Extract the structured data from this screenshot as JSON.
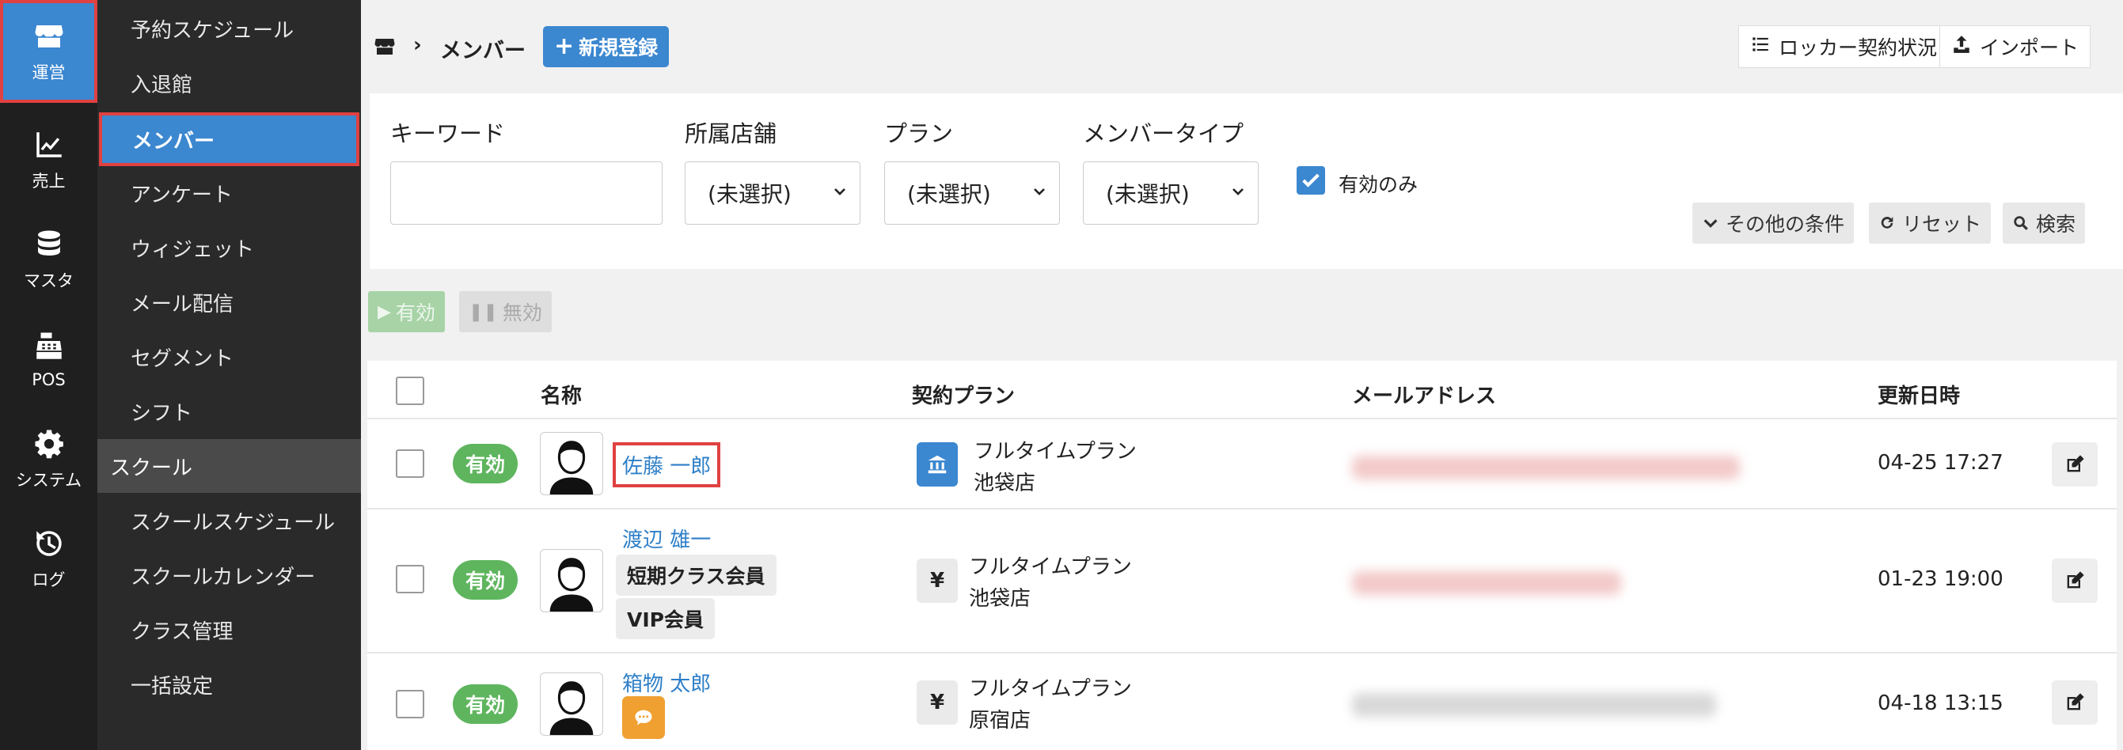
{
  "rail": [
    {
      "label": "運営",
      "icon": "store-icon"
    },
    {
      "label": "売上",
      "icon": "chart-line-icon"
    },
    {
      "label": "マスタ",
      "icon": "database-icon"
    },
    {
      "label": "POS",
      "icon": "cash-register-icon"
    },
    {
      "label": "システム",
      "icon": "gear-icon"
    },
    {
      "label": "ログ",
      "icon": "history-icon"
    }
  ],
  "nav": [
    {
      "label": "予約スケジュール"
    },
    {
      "label": "入退館"
    },
    {
      "label": "メンバー"
    },
    {
      "label": "アンケート"
    },
    {
      "label": "ウィジェット"
    },
    {
      "label": "メール配信"
    },
    {
      "label": "セグメント"
    },
    {
      "label": "シフト"
    },
    {
      "label": "スクール"
    },
    {
      "label": "スクールスケジュール"
    },
    {
      "label": "スクールカレンダー"
    },
    {
      "label": "クラス管理"
    },
    {
      "label": "一括設定"
    }
  ],
  "breadcrumb": {
    "separator": "›",
    "current": "メンバー"
  },
  "toolbar": {
    "new_label": "新規登録",
    "locker_label": "ロッカー契約状況",
    "import_label": "インポート"
  },
  "filter": {
    "keyword_label": "キーワード",
    "keyword_value": "",
    "store_label": "所属店舗",
    "store_value": "(未選択)",
    "plan_label": "プラン",
    "plan_value": "(未選択)",
    "type_label": "メンバータイプ",
    "type_value": "(未選択)",
    "active_only_label": "有効のみ",
    "active_only_checked": true,
    "more_label": "その他の条件",
    "reset_label": "リセット",
    "search_label": "検索"
  },
  "actions": {
    "enable_label": "有効",
    "disable_label": "無効"
  },
  "table": {
    "headers": {
      "name": "名称",
      "plan": "契約プラン",
      "email": "メールアドレス",
      "updated": "更新日時"
    },
    "rows": [
      {
        "status": "有効",
        "name": "佐藤 一郎",
        "tags": [],
        "plan": "フルタイムプラン",
        "store": "池袋店",
        "plan_icon": "bank-icon",
        "updated": "04-25 17:27"
      },
      {
        "status": "有効",
        "name": "渡辺 雄一",
        "tags": [
          "短期クラス会員",
          "VIP会員"
        ],
        "plan": "フルタイムプラン",
        "store": "池袋店",
        "plan_icon": "yen-icon",
        "plan_icon_text": "¥",
        "updated": "01-23 19:00"
      },
      {
        "status": "有効",
        "name": "箱物 太郎",
        "tags": [],
        "chat_icon": "chat-icon",
        "plan": "フルタイムプラン",
        "store": "原宿店",
        "plan_icon": "yen-icon",
        "plan_icon_text": "¥",
        "updated": "04-18 13:15"
      }
    ]
  },
  "colors": {
    "accent": "#3b87d0",
    "highlight": "#e04141",
    "status_green": "#5eb55e",
    "link": "#2e7fc8",
    "rail_bg": "#1f1f1f",
    "nav_bg": "#2a2a2a"
  }
}
